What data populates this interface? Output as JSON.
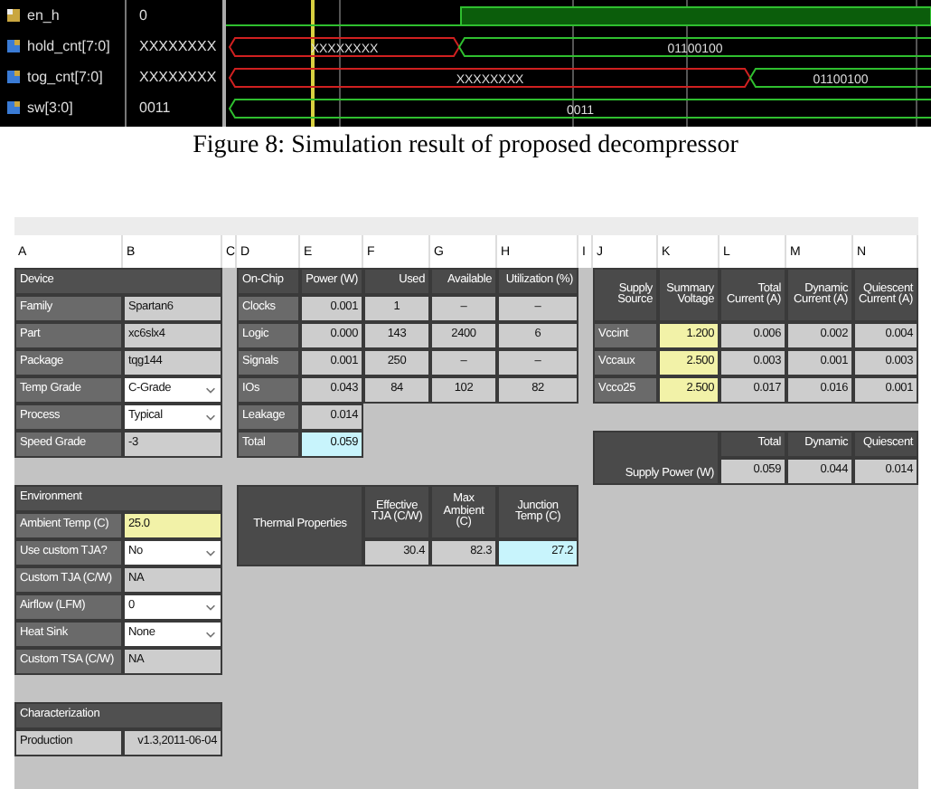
{
  "waveform": {
    "signals": [
      {
        "name": "en_h",
        "value": "0",
        "kind": "bit"
      },
      {
        "name": "hold_cnt[7:0]",
        "value": "XXXXXXXX",
        "kind": "bus",
        "segments": [
          {
            "label": "XXXXXXXX",
            "unknown": true
          },
          {
            "label": "01100100",
            "unknown": false
          }
        ]
      },
      {
        "name": "tog_cnt[7:0]",
        "value": "XXXXXXXX",
        "kind": "bus",
        "segments": [
          {
            "label": "XXXXXXXX",
            "unknown": true
          },
          {
            "label": "01100100",
            "unknown": false
          }
        ]
      },
      {
        "name": "sw[3:0]",
        "value": "0011",
        "kind": "bus",
        "segments": [
          {
            "label": "0011",
            "unknown": false
          }
        ]
      }
    ]
  },
  "caption": "Figure 8: Simulation result of proposed decompressor",
  "sheet": {
    "column_letters": [
      "A",
      "B",
      "C",
      "D",
      "E",
      "F",
      "G",
      "H",
      "I",
      "J",
      "K",
      "L",
      "M",
      "N"
    ],
    "device": {
      "title": "Device",
      "rows": [
        {
          "label": "Family",
          "value": "Spartan6",
          "kind": "text"
        },
        {
          "label": "Part",
          "value": "xc6slx4",
          "kind": "text"
        },
        {
          "label": "Package",
          "value": "tqg144",
          "kind": "text"
        },
        {
          "label": "Temp Grade",
          "value": "C-Grade",
          "kind": "select"
        },
        {
          "label": "Process",
          "value": "Typical",
          "kind": "select"
        },
        {
          "label": "Speed Grade",
          "value": "-3",
          "kind": "text"
        }
      ]
    },
    "on_chip": {
      "columns": [
        "On-Chip",
        "Power (W)",
        "Used",
        "Available",
        "Utilization (%)"
      ],
      "rows": [
        [
          "Clocks",
          "0.001",
          "1",
          "–",
          "–"
        ],
        [
          "Logic",
          "0.000",
          "143",
          "2400",
          "6"
        ],
        [
          "Signals",
          "0.001",
          "250",
          "–",
          "–"
        ],
        [
          "IOs",
          "0.043",
          "84",
          "102",
          "82"
        ],
        [
          "Leakage",
          "0.014"
        ],
        [
          "Total",
          {
            "text": "0.059",
            "kind": "result"
          }
        ]
      ]
    },
    "supply_summary": {
      "columns": [
        "Supply Source",
        "Summary Voltage",
        "Total Current (A)",
        "Dynamic Current (A)",
        "Quiescent Current (A)"
      ],
      "rows": [
        [
          "Vccint",
          {
            "text": "1.200",
            "kind": "input"
          },
          "0.006",
          "0.002",
          "0.004"
        ],
        [
          "Vccaux",
          {
            "text": "2.500",
            "kind": "input"
          },
          "0.003",
          "0.001",
          "0.003"
        ],
        [
          "Vcco25",
          {
            "text": "2.500",
            "kind": "input"
          },
          "0.017",
          "0.016",
          "0.001"
        ]
      ]
    },
    "supply_power": {
      "columns": [
        "Total",
        "Dynamic",
        "Quiescent"
      ],
      "label": "Supply Power (W)",
      "values": [
        "0.059",
        "0.044",
        "0.014"
      ]
    },
    "environment": {
      "title": "Environment",
      "rows": [
        {
          "label": "Ambient Temp (C)",
          "value": "25.0",
          "kind": "input"
        },
        {
          "label": "Use custom TJA?",
          "value": "No",
          "kind": "select"
        },
        {
          "label": "Custom TJA (C/W)",
          "value": "NA",
          "kind": "text"
        },
        {
          "label": "Airflow (LFM)",
          "value": "0",
          "kind": "select"
        },
        {
          "label": "Heat Sink",
          "value": "None",
          "kind": "select"
        },
        {
          "label": "Custom TSA (C/W)",
          "value": "NA",
          "kind": "text"
        }
      ]
    },
    "thermal": {
      "title": "Thermal Properties",
      "columns": [
        "Effective TJA (C/W)",
        "Max Ambient (C)",
        "Junction Temp (C)"
      ],
      "values": [
        "30.4",
        "82.3",
        {
          "text": "27.2",
          "kind": "result"
        }
      ]
    },
    "characterization": {
      "title": "Characterization",
      "label": "Production",
      "value": "v1.3,2011-06-04"
    }
  }
}
